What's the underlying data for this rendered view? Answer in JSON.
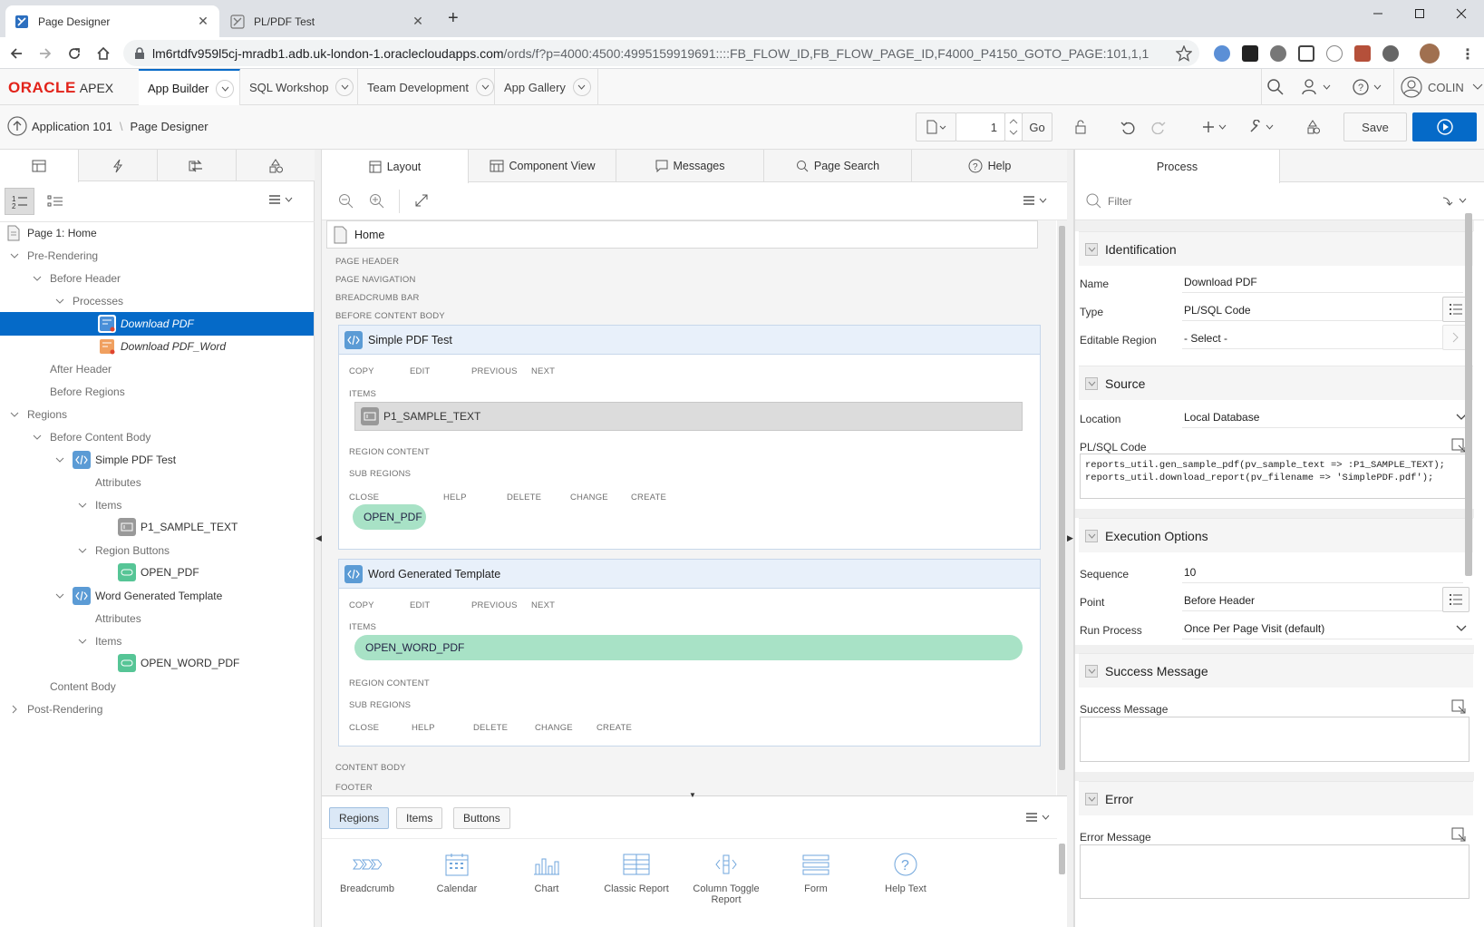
{
  "browser": {
    "tabs": [
      {
        "title": "Page Designer",
        "active": true
      },
      {
        "title": "PL/PDF Test",
        "active": false
      }
    ],
    "url_host": "lm6rtdfv959l5cj-mradb1.adb.uk-london-1.oraclecloudapps.com",
    "url_path": "/ords/f?p=4000:4500:4995159919691::::FB_FLOW_ID,FB_FLOW_PAGE_ID,F4000_P4150_GOTO_PAGE:101,1,1"
  },
  "apex": {
    "logo_oracle": "ORACLE",
    "logo_apex": "APEX",
    "nav": [
      "App Builder",
      "SQL Workshop",
      "Team Development",
      "App Gallery"
    ],
    "user": "COLIN"
  },
  "toolbar": {
    "breadcrumb_app": "Application 101",
    "breadcrumb_page": "Page Designer",
    "page_number": "1",
    "go_label": "Go",
    "save_label": "Save"
  },
  "tree": {
    "page": "Page 1: Home",
    "pre_rendering": "Pre-Rendering",
    "before_header": "Before Header",
    "processes": "Processes",
    "proc1": "Download PDF",
    "proc2": "Download PDF_Word",
    "after_header": "After Header",
    "before_regions": "Before Regions",
    "regions": "Regions",
    "before_content_body": "Before Content Body",
    "region1": "Simple PDF Test",
    "attributes": "Attributes",
    "items": "Items",
    "item1": "P1_SAMPLE_TEXT",
    "region_buttons": "Region Buttons",
    "btn1": "OPEN_PDF",
    "region2": "Word Generated Template",
    "item2": "OPEN_WORD_PDF",
    "content_body": "Content Body",
    "post_rendering": "Post-Rendering"
  },
  "center": {
    "tabs": [
      "Layout",
      "Component View",
      "Messages",
      "Page Search",
      "Help"
    ],
    "page_name": "Home",
    "positions": {
      "page_header": "PAGE HEADER",
      "page_navigation": "PAGE NAVIGATION",
      "breadcrumb_bar": "BREADCRUMB BAR",
      "before_content_body": "BEFORE CONTENT BODY",
      "content_body": "CONTENT BODY",
      "footer": "FOOTER"
    },
    "region1": {
      "title": "Simple PDF Test",
      "top_positions": [
        "COPY",
        "EDIT",
        "PREVIOUS",
        "NEXT"
      ],
      "items_label": "ITEMS",
      "item": "P1_SAMPLE_TEXT",
      "region_content": "REGION CONTENT",
      "sub_regions": "SUB REGIONS",
      "bottom_positions": [
        "CLOSE",
        "HELP",
        "DELETE",
        "CHANGE",
        "CREATE"
      ],
      "button": "OPEN_PDF"
    },
    "region2": {
      "title": "Word Generated Template",
      "top_positions": [
        "COPY",
        "EDIT",
        "PREVIOUS",
        "NEXT"
      ],
      "items_label": "ITEMS",
      "item": "OPEN_WORD_PDF",
      "region_content": "REGION CONTENT",
      "sub_regions": "SUB REGIONS",
      "bottom_positions": [
        "CLOSE",
        "HELP",
        "DELETE",
        "CHANGE",
        "CREATE"
      ]
    },
    "gallery_tabs": [
      "Regions",
      "Items",
      "Buttons"
    ],
    "gallery": [
      "Breadcrumb",
      "Calendar",
      "Chart",
      "Classic Report",
      "Column Toggle Report",
      "Form",
      "Help Text"
    ]
  },
  "props": {
    "tab": "Process",
    "filter_placeholder": "Filter",
    "identification": "Identification",
    "name_label": "Name",
    "name_value": "Download PDF",
    "type_label": "Type",
    "type_value": "PL/SQL Code",
    "editable_label": "Editable Region",
    "editable_value": "- Select -",
    "source": "Source",
    "location_label": "Location",
    "location_value": "Local Database",
    "plsql_label": "PL/SQL Code",
    "plsql_code": "reports_util.gen_sample_pdf(pv_sample_text => :P1_SAMPLE_TEXT);\nreports_util.download_report(pv_filename => 'SimplePDF.pdf');",
    "execution": "Execution Options",
    "sequence_label": "Sequence",
    "sequence_value": "10",
    "point_label": "Point",
    "point_value": "Before Header",
    "run_label": "Run Process",
    "run_value": "Once Per Page Visit (default)",
    "success_section": "Success Message",
    "success_label": "Success Message",
    "error_section": "Error",
    "error_label": "Error Message"
  }
}
